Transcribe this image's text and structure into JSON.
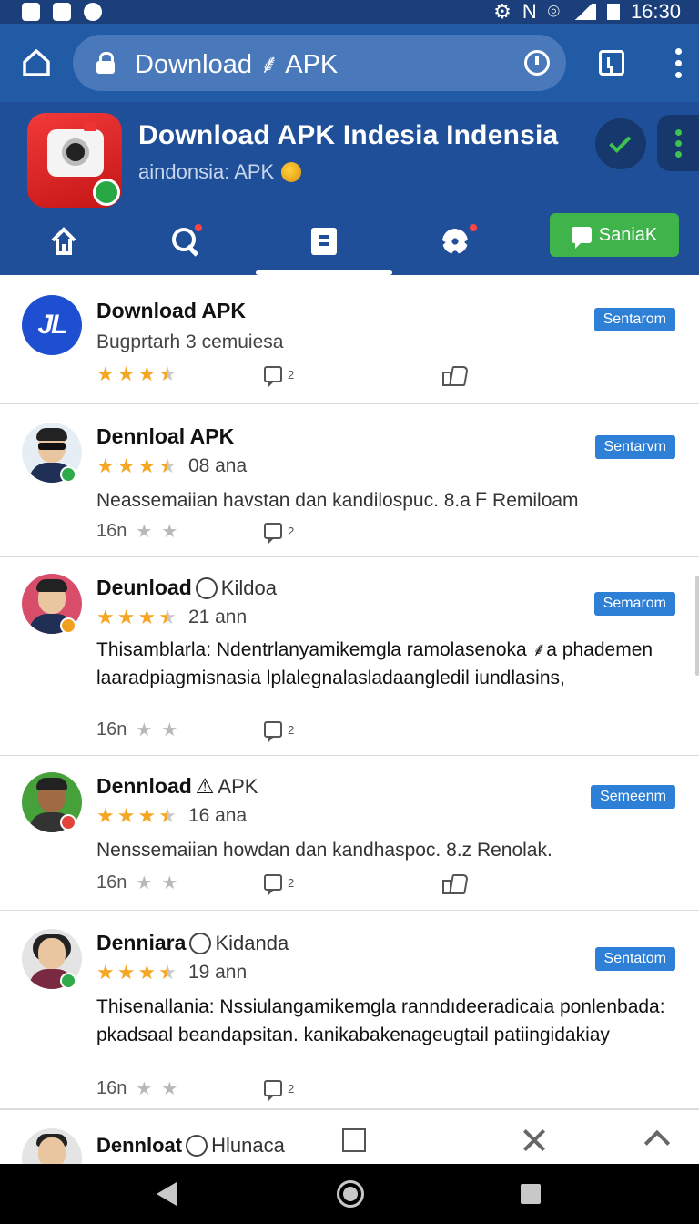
{
  "status_bar": {
    "time": "16:30"
  },
  "url_bar": {
    "url": "Download ⸙ APK"
  },
  "app": {
    "title": "Download APK Indesia Indensia",
    "subtitle": "aindonsia: APK",
    "action_button": "SaniaK"
  },
  "colors": {
    "header": "#1f4f98",
    "accent_green": "#3fb44a",
    "badge": "#2e7fd6",
    "star": "#f5a623"
  },
  "items": [
    {
      "title": "Download APK",
      "subtitle": "Bugprtarh 3 cemuiesa",
      "badge": "Sentarom",
      "comments": "2"
    },
    {
      "title": "Dennloal APK",
      "rating_text": "08 ana",
      "description": "Neassemaiian havstan dan kandilospuc. 8.a ᖴ Remiloam",
      "time": "16n",
      "badge": "Sentarvm",
      "comments": "2"
    },
    {
      "title": "Deunload",
      "title_extra": "Kildoa",
      "rating_text": "21 ann",
      "description": "Thisamblarla: Ndentrlanyamikemgla ramolasenoka ⸙a phademen laaradpiagmisnasia lplalegnalasladaangledil iundlasins,",
      "time": "16n",
      "badge": "Semarom",
      "comments": "2"
    },
    {
      "title": "Dennload",
      "title_extra": "APK",
      "rating_text": "16 ana",
      "description": "Nenssemaiian howdan dan kandhaspoc. 8.z Renolak.",
      "time": "16n",
      "badge": "Semeenm",
      "comments": "2"
    },
    {
      "title": "Denniara",
      "title_extra": "Kidanda",
      "rating_text": "19 ann",
      "description": "Thisenallania: Nssiulangamikemgla ranndıdeeradicaia ponlenbada: pkadsaal beandapsitan. kanikabakenageugtail patiingidakiay",
      "time": "16n",
      "badge": "Sentatom",
      "comments": "2"
    }
  ],
  "peek": {
    "title": "Dennloat",
    "title_extra": "Hlunaca"
  }
}
